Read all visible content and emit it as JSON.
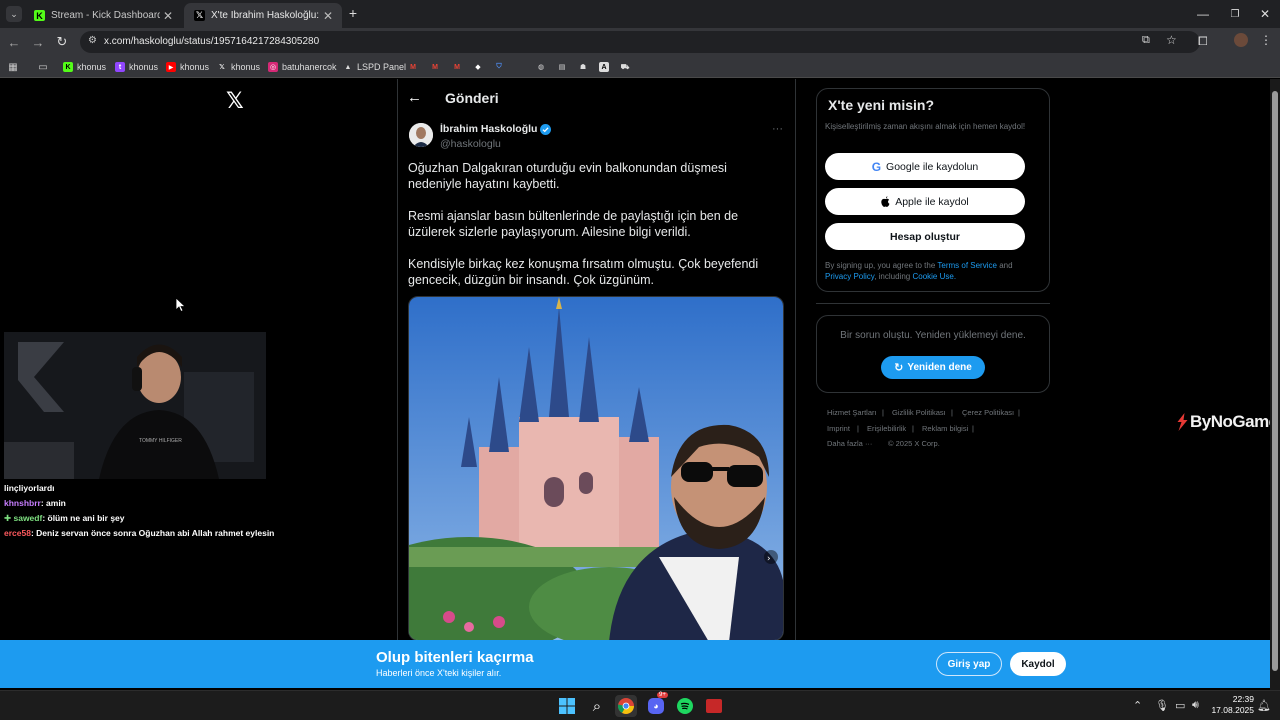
{
  "browser": {
    "tabs": [
      {
        "title": "Stream - Kick Dashboard",
        "active": false
      },
      {
        "title": "X'te İbrahim Haskoloğlu: \"Oğuz",
        "active": true
      }
    ],
    "url": "x.com/haskologlu/status/1957164217284305280",
    "bookmarks": [
      "khonus",
      "khonus",
      "khonus",
      "khonus",
      "batuhanercok",
      "LSPD Panel"
    ]
  },
  "nav": {
    "page_title": "Gönderi"
  },
  "tweet": {
    "author_name": "İbrahim Haskoloğlu",
    "handle": "@haskologlu",
    "paragraphs": [
      "Oğuzhan Dalgakıran oturduğu evin balkonundan düşmesi nedeniyle hayatını kaybetti.",
      "Resmi ajanslar basın bültenlerinde de paylaştığı için ben de üzülerek sizlerle paylaşıyorum. Ailesine bilgi verildi.",
      "Kendisiyle birkaç kez konuşma fırsatım olmuştu. Çok beyefendi gencecik, düzgün bir insandı. Çok üzgünüm."
    ],
    "more": "···"
  },
  "signup": {
    "title": "X'te yeni misin?",
    "subtitle": "Kişiselleştirilmiş zaman akışını almak için hemen kaydol!",
    "google": "Google ile kaydolun",
    "apple": "Apple ile kaydol",
    "create": "Hesap oluştur",
    "legal_1": "By signing up, you agree to the",
    "terms": "Terms of Service",
    "and": "and",
    "privacy": "Privacy Policy",
    "including": ", including",
    "cookie": "Cookie Use."
  },
  "error_box": {
    "message": "Bir sorun oluştu. Yeniden yüklemeyi dene.",
    "retry": "Yeniden dene"
  },
  "footer": {
    "links": [
      "Hizmet Şartları",
      "Gizlilik Politikası",
      "Çerez Politikası",
      "Imprint",
      "Erişilebilirlik",
      "Reklam bilgisi",
      "Daha fazla ···"
    ],
    "copyright": "© 2025 X Corp."
  },
  "overlay": {
    "watermark": "ByNoGame",
    "chat": [
      {
        "user": "",
        "text": "linçliyorlardı"
      },
      {
        "user": "khnshbrr",
        "text": ": amin",
        "color": "#c77dff"
      },
      {
        "user": "sawedf",
        "text": ": ölüm ne ani bir şey",
        "color": "#7ee081"
      },
      {
        "user": "erce58",
        "text": ": Deniz servan önce sonra Oğuzhan abi Allah rahmet eylesin",
        "color": "#ff5a5f"
      }
    ]
  },
  "banner": {
    "title": "Olup bitenleri kaçırma",
    "subtitle": "Haberleri önce X'teki kişiler alır.",
    "login": "Giriş yap",
    "signup": "Kaydol"
  },
  "taskbar": {
    "time": "22:39",
    "date": "17.08.2025",
    "discord_badge": "9+"
  },
  "colors": {
    "accent": "#1d9bf0",
    "background": "#000000",
    "verified": "#1d9bf0"
  }
}
